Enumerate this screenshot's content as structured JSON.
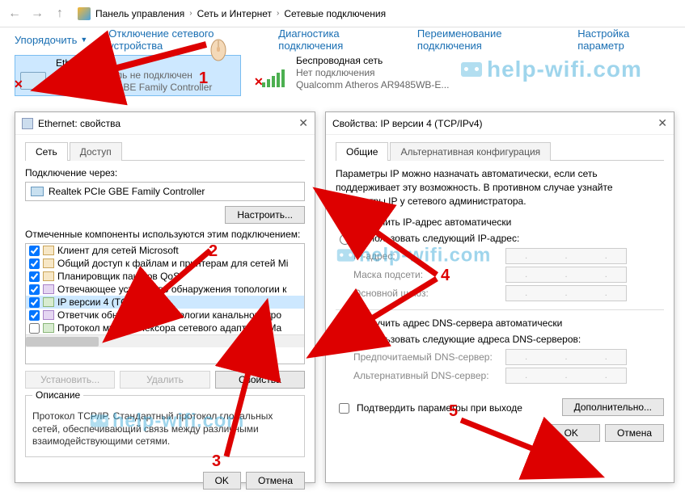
{
  "breadcrumb": {
    "root": "Панель управления",
    "l2": "Сеть и Интернет",
    "l3": "Сетевые подключения"
  },
  "menubar": {
    "organize": "Упорядочить",
    "disable": "Отключение сетевого устройства",
    "diagnose": "Диагностика подключения",
    "rename": "Переименование подключения",
    "settings": "Настройка параметр"
  },
  "connections": {
    "eth": {
      "name": "Ethernet",
      "status": "Сетевой кабель не подключен",
      "device": "Realtek PCIe GBE Family Controller"
    },
    "wifi": {
      "name": "Беспроводная сеть",
      "status": "Нет подключения",
      "device": "Qualcomm Atheros AR9485WB-E..."
    }
  },
  "dlg1": {
    "title": "Ethernet: свойства",
    "tab_net": "Сеть",
    "tab_access": "Доступ",
    "connect_via": "Подключение через:",
    "adapter": "Realtek PCIe GBE Family Controller",
    "configure": "Настроить...",
    "comp_label": "Отмеченные компоненты используются этим подключением:",
    "components": [
      "Клиент для сетей Microsoft",
      "Общий доступ к файлам и принтерам для сетей Mi",
      "Планировщик пакетов QoS",
      "Отвечающее устройство обнаружения топологии к",
      "IP версии 4 (TCP/IPv4)",
      "Ответчик обнаружения топологии канального уро",
      "Протокол мультиплексора сетевого адаптера (Ma"
    ],
    "install": "Установить...",
    "remove": "Удалить",
    "properties": "Свойства",
    "desc_title": "Описание",
    "desc": "Протокол TCP/IP. Стандартный протокол глобальных сетей, обеспечивающий связь между различными взаимодействующими сетями.",
    "ok": "OK",
    "cancel": "Отмена"
  },
  "dlg2": {
    "title": "Свойства: IP версии 4 (TCP/IPv4)",
    "tab_general": "Общие",
    "tab_alt": "Альтернативная конфигурация",
    "info": "Параметры IP можно назначать автоматически, если сеть поддерживает эту возможность. В противном случае узнайте параметры IP у сетевого администратора.",
    "ip_auto": "Получить IP-адрес автоматически",
    "ip_manual": "Использовать следующий IP-адрес:",
    "ip_addr": "IP-адрес:",
    "mask": "Маска подсети:",
    "gateway": "Основной шлюз:",
    "dns_auto": "Получить адрес DNS-сервера автоматически",
    "dns_manual": "Использовать следующие адреса DNS-серверов:",
    "dns_pref": "Предпочитаемый DNS-сервер:",
    "dns_alt": "Альтернативный DNS-сервер:",
    "confirm": "Подтвердить параметры при выходе",
    "advanced": "Дополнительно...",
    "ok": "OK",
    "cancel": "Отмена"
  },
  "watermark": "help-wifi.com",
  "numbers": {
    "n1": "1",
    "n2": "2",
    "n3": "3",
    "n4": "4",
    "n5": "5"
  }
}
